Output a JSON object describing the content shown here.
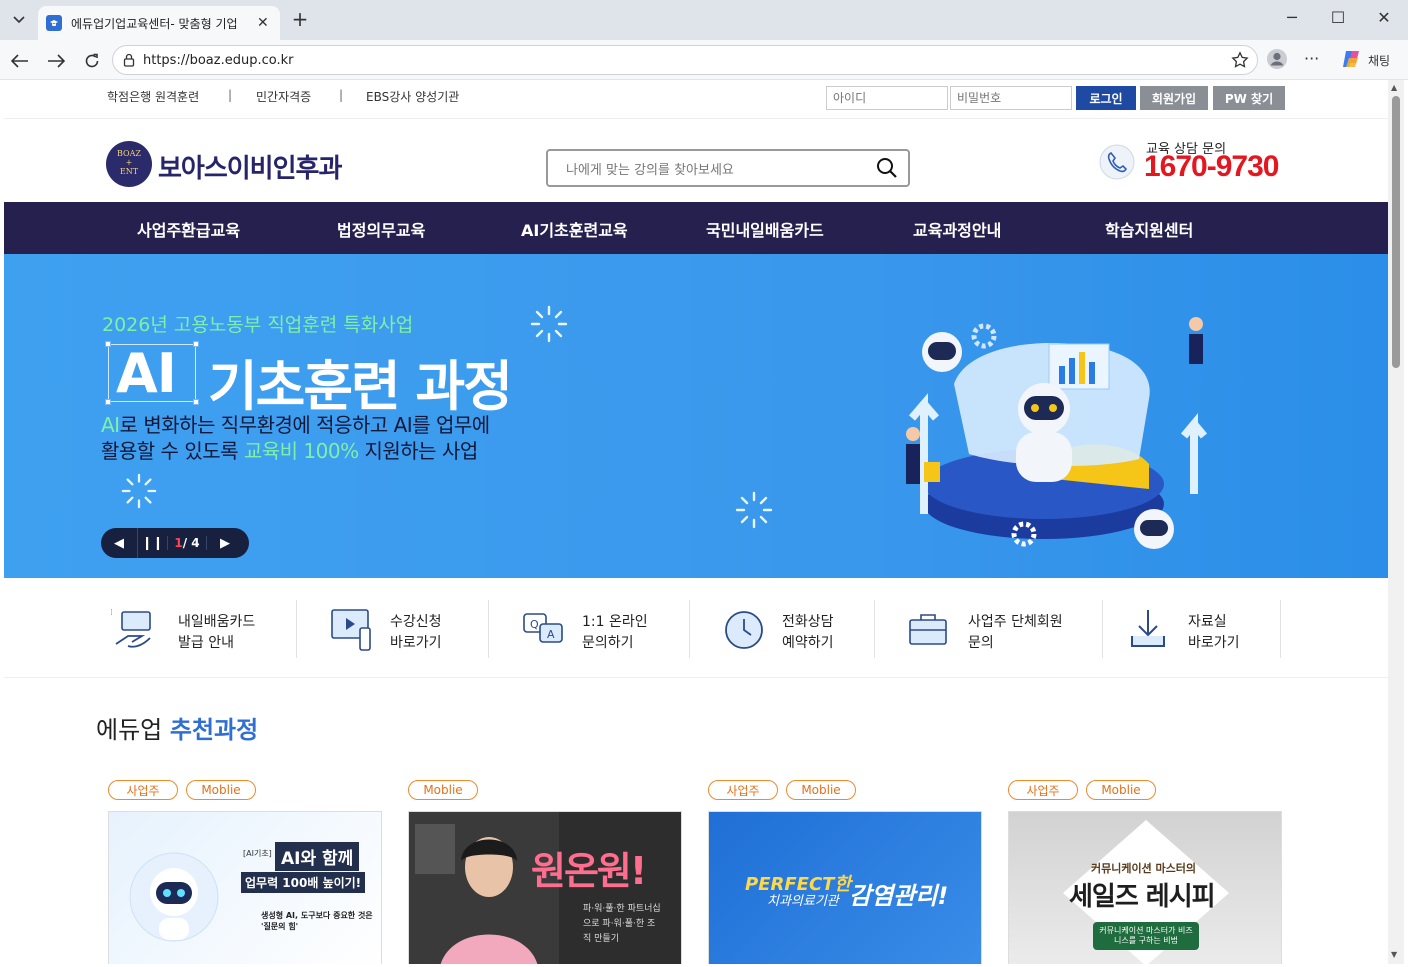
{
  "browser": {
    "tab_title": "에듀업기업교육센터- 맞춤형 기업",
    "url": "https://boaz.edup.co.kr",
    "chat_label": "채팅"
  },
  "util": {
    "links": [
      "학점은행 원격훈련",
      "민간자격증",
      "EBS강사 양성기관"
    ],
    "separator": "|",
    "id_placeholder": "아이디",
    "pw_placeholder": "비밀번호",
    "login": "로그인",
    "signup": "회원가입",
    "find_pw": "PW 찾기"
  },
  "header": {
    "logo_badge": [
      "BOAZ",
      "+",
      "ENT"
    ],
    "logo_text": "보아스이비인후과",
    "search_placeholder": "나에게 맞는 강의를 찾아보세요",
    "phone_label": "교육 상담 문의",
    "phone_number": "1670-9730"
  },
  "gnb": [
    "사업주환급교육",
    "법정의무교육",
    "AI기초훈련교육",
    "국민내일배움카드",
    "교육과정안내",
    "학습지원센터"
  ],
  "hero": {
    "subtitle": "2026년 고용노동부 직업훈련 특화사업",
    "title_ai": "AI",
    "title_rest": "기초훈련 과정",
    "desc_1_highlight": "AI",
    "desc_1_rest": "로 변화하는 직무환경에 적응하고 AI를 업무에",
    "desc_2_a": "활용할 수 있도록 ",
    "desc_2_highlight": "교육비 100%",
    "desc_2_b": " 지원하는 사업",
    "slide_current": "1",
    "slide_total": "/ 4"
  },
  "quick_menu": [
    {
      "line1": "내일배움카드",
      "line2": "발급 안내",
      "icon": "card-hand-icon"
    },
    {
      "line1": "수강신청",
      "line2": "바로가기",
      "icon": "video-screen-icon"
    },
    {
      "line1": "1:1 온라인",
      "line2": "문의하기",
      "icon": "qa-chat-icon"
    },
    {
      "line1": "전화상담",
      "line2": "예약하기",
      "icon": "phone-clock-icon"
    },
    {
      "line1": "사업주 단체회원",
      "line2": "문의",
      "icon": "briefcase-icon"
    },
    {
      "line1": "자료실",
      "line2": "바로가기",
      "icon": "download-icon"
    }
  ],
  "recommended": {
    "title_a": "에듀업 ",
    "title_b": "추천과정",
    "cards": [
      {
        "badges": [
          "사업주",
          "Moblie"
        ],
        "text_a": "AI와 함께",
        "text_b": "업무력 100배 높이기!",
        "text_c": "생성형 AI, 도구보다 중요한 것은 '질문의 힘'",
        "tag": "[AI기초]",
        "colors": [
          "#dceefc",
          "#ffffff"
        ]
      },
      {
        "badges": [
          "Moblie"
        ],
        "text_a": "원온원!",
        "text_b": "파·워·풀·한 파트너십으로 파·워·풀·한 조직 만들기",
        "colors": [
          "#2b2b2b",
          "#444"
        ]
      },
      {
        "badges": [
          "사업주",
          "Moblie"
        ],
        "text_a": "PERFECT한",
        "text_b": "치과의료기관",
        "text_c": "감염관리!",
        "colors": [
          "#1f6fd6",
          "#3a8de8"
        ]
      },
      {
        "badges": [
          "사업주",
          "Moblie"
        ],
        "text_a": "커뮤니케이션 마스터의",
        "text_b": "세일즈 레시피",
        "text_c": "커뮤니케이션 마스터가 비즈니스를 구하는 비법",
        "colors": [
          "#cfcfcf",
          "#eaeaea"
        ]
      }
    ]
  },
  "colors": {
    "navy": "#26204f",
    "accent_blue": "#2f6fd4",
    "phone_red": "#e4161f",
    "badge_orange": "#f08a2a",
    "hero_green": "#7ff0a7"
  }
}
